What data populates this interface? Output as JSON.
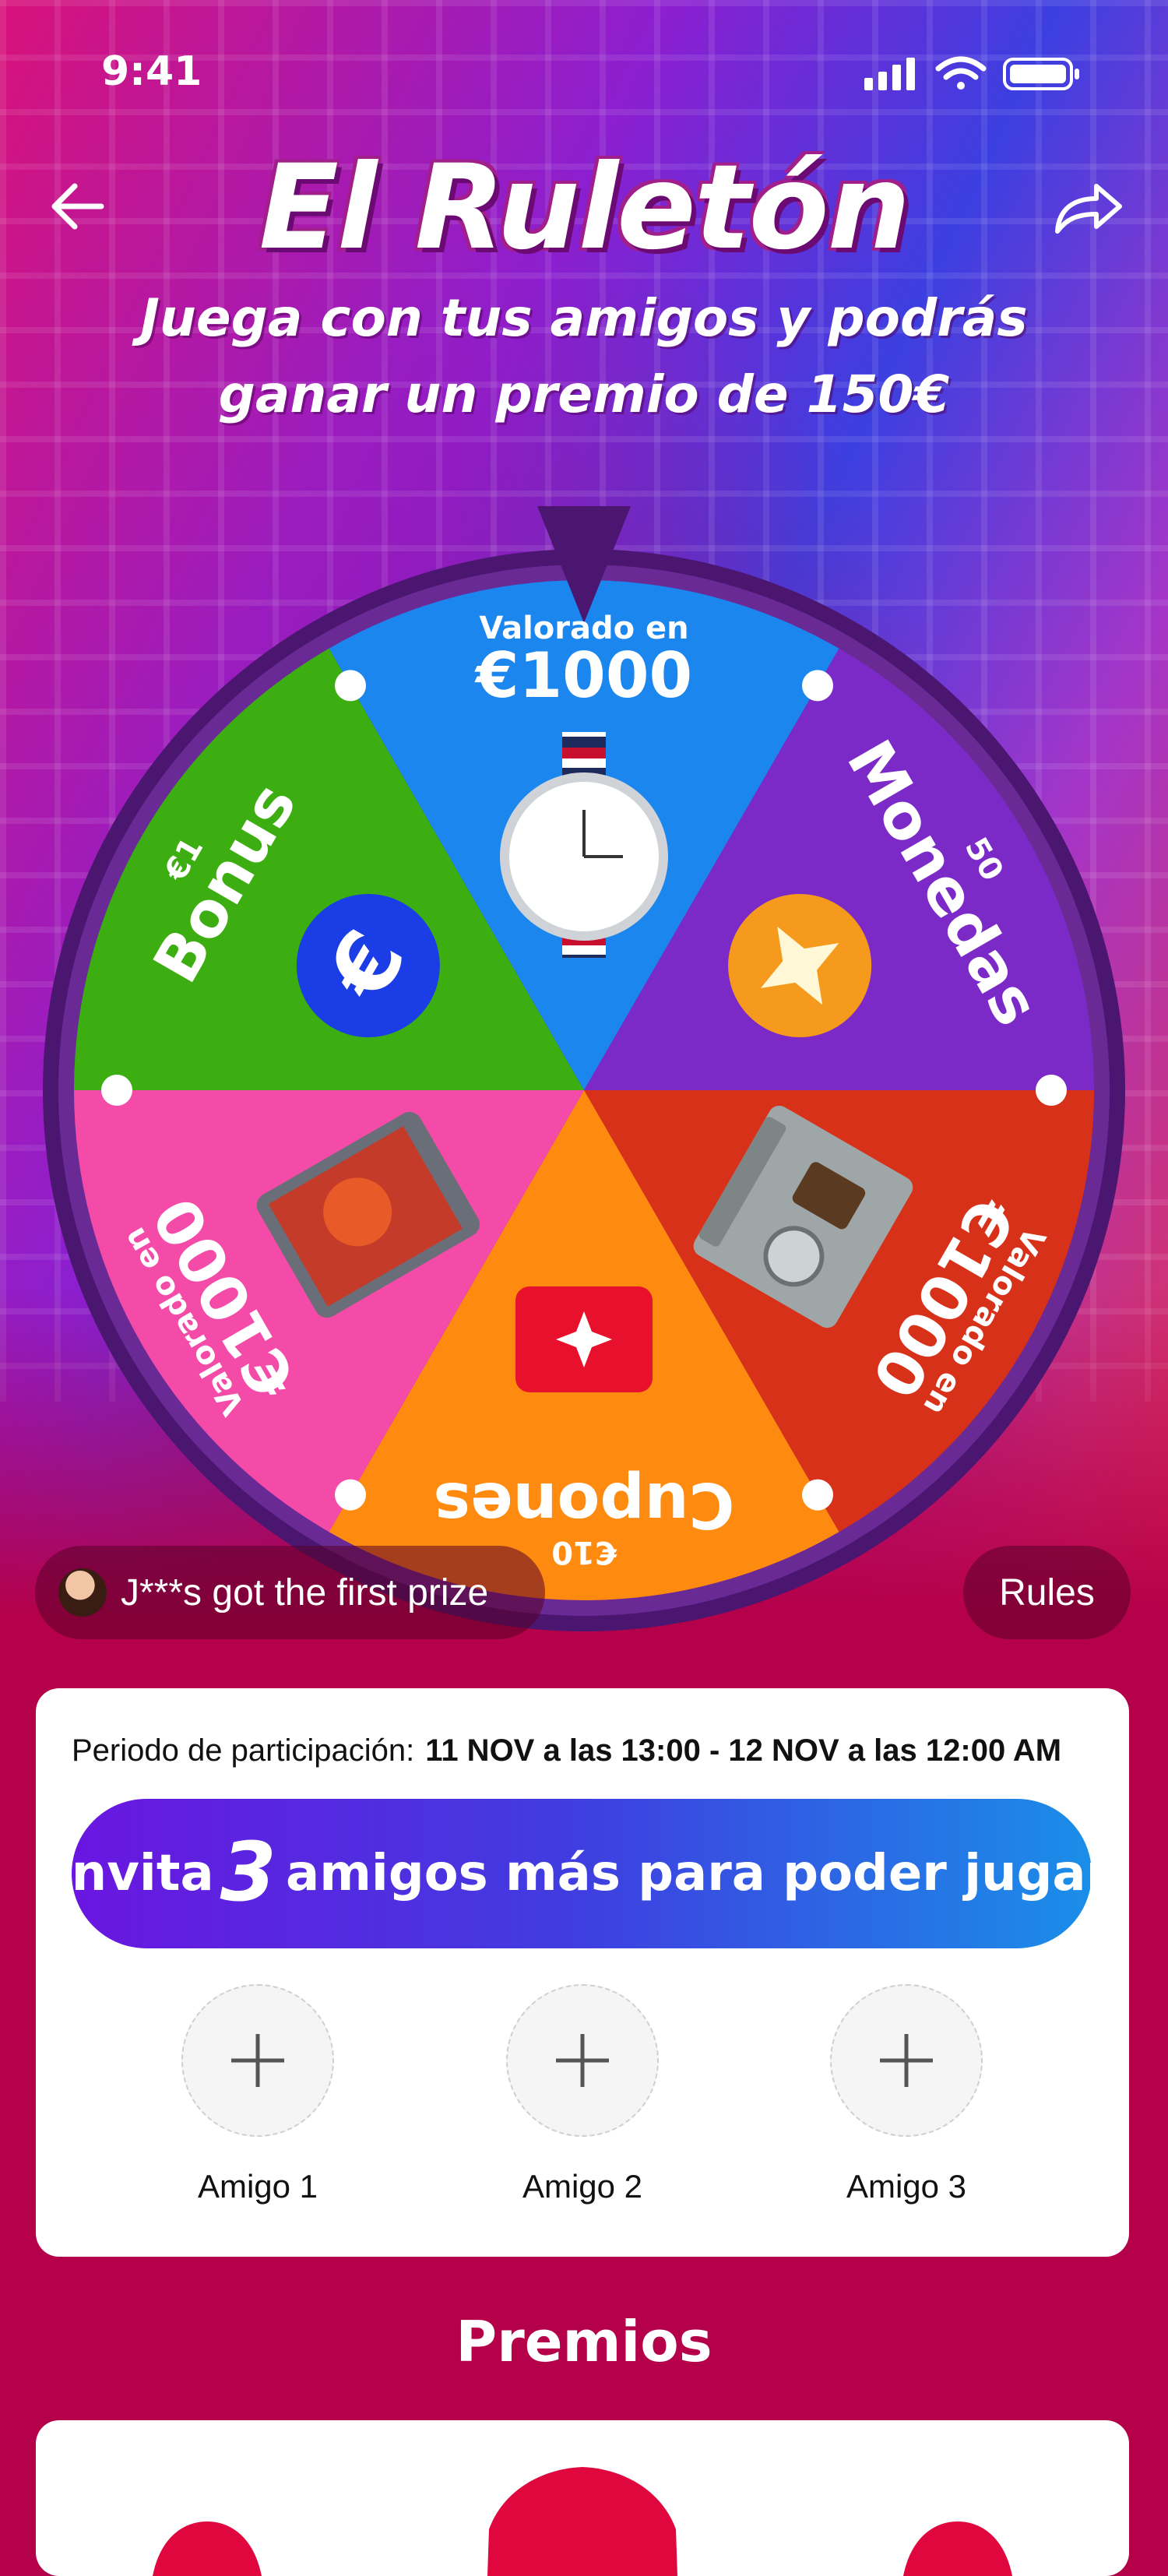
{
  "status": {
    "time": "9:41"
  },
  "header": {
    "title": "El Ruletón",
    "subtitle_line1": "Juega con tus amigos y podrás",
    "subtitle_line2": "ganar un premio de 150€"
  },
  "wheel": {
    "segments": [
      {
        "top": "Valorado en",
        "main": "€1000",
        "color": "#1b86ee",
        "icon": "watch-image"
      },
      {
        "top": "50",
        "main": "Monedas",
        "color": "#7b2ac8",
        "icon": "star-coin-icon"
      },
      {
        "top": "Valorado en",
        "main": "€1000",
        "color": "#d8311a",
        "icon": "coffee-machine-image"
      },
      {
        "top": "€10",
        "main": "Cupones",
        "color": "#ff8a10",
        "icon": "coupon-icon"
      },
      {
        "top": "Valorado en",
        "main": "€1000",
        "color": "#f44aa8",
        "icon": "phone-image"
      },
      {
        "top": "€1",
        "main": "Bonus",
        "color": "#3cae12",
        "icon": "euro-coin-icon"
      }
    ]
  },
  "ticker": {
    "text": "J***s got the first prize"
  },
  "rules_label": "Rules",
  "card": {
    "period_label": "Periodo de participación:",
    "period_value": "11 NOV a las 13:00 - 12 NOV a las 12:00 AM",
    "invite_prefix": "Invita",
    "invite_count": "3",
    "invite_suffix": "amigos más para poder jugar",
    "friends": [
      "Amigo 1",
      "Amigo 2",
      "Amigo 3"
    ]
  },
  "prizes_title": "Premios",
  "colors": {
    "background": "#b5004a",
    "invite_start": "#6a16e0",
    "invite_end": "#1a8ee8"
  }
}
